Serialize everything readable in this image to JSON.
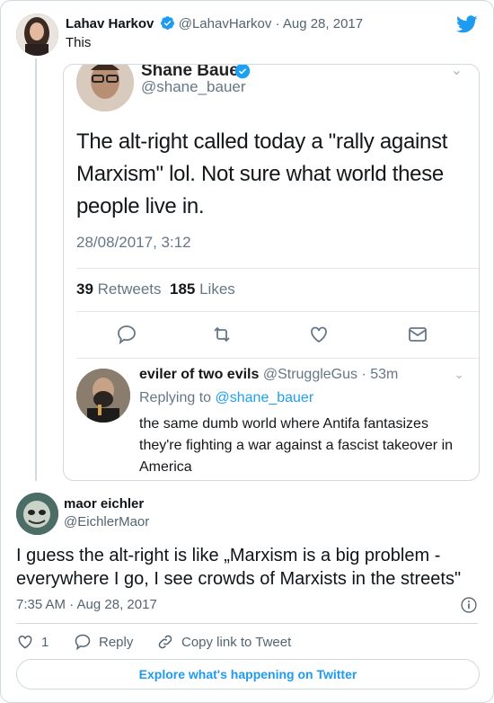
{
  "parent": {
    "name": "Lahav Harkov",
    "handle": "@LahavHarkov",
    "date": "· Aug 28, 2017",
    "text": "This"
  },
  "embed": {
    "author_name": "Shane Bauer",
    "author_handle": "@shane_bauer",
    "text": "The alt-right called today a \"rally against Marxism\" lol. Not sure what world these people live in.",
    "date": "28/08/2017, 3:12",
    "retweets_count": "39",
    "retweets_label": "Retweets",
    "likes_count": "185",
    "likes_label": "Likes",
    "reply": {
      "name": "eviler of two evils",
      "handle_time": "@StruggleGus · 53m",
      "replying_label": "Replying to",
      "replying_handle": "@shane_bauer",
      "text": "the same dumb world where Antifa fantasizes they're fighting a war against a fascist takeover in America"
    }
  },
  "tweet": {
    "name": "maor eichler",
    "handle": "@EichlerMaor",
    "text": "I guess the alt-right is like „Marxism is a big problem - everywhere I go, I see crowds of Marxists in the streets\"",
    "timestamp": "7:35 AM · Aug 28, 2017",
    "likes_count": "1",
    "reply_label": "Reply",
    "copy_link_label": "Copy link to Tweet"
  },
  "explore_label": "Explore what's happening on Twitter",
  "colors": {
    "accent": "#1d9bf0",
    "text": "#0f1419",
    "muted": "#536471",
    "border": "#cfd9de"
  }
}
